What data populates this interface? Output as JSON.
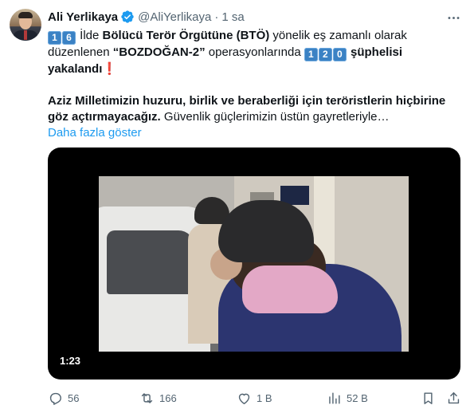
{
  "author": {
    "name": "Ali Yerlikaya",
    "handle": "@AliYerlikaya",
    "separator": "·",
    "time": "1 sa"
  },
  "tweet": {
    "line1": {
      "keys1": [
        "1",
        "6"
      ],
      "t1": " İlde ",
      "b1": "Bölücü Terör Örgütüne (BTÖ)",
      "t2": " yönelik eş zamanlı olarak"
    },
    "line2": {
      "t1": "düzenlenen ",
      "b1": "“BOZDOĞAN-2”",
      "t2": " operasyonlarında ",
      "keys2": [
        "1",
        "2",
        "0"
      ],
      "b2": " şüphelisi"
    },
    "line3": {
      "b1": "yakalandı",
      "mark": "❗"
    },
    "line4": {
      "b1": "Aziz Milletimizin huzuru, birlik ve beraberliği için teröristlerin hiçbirine"
    },
    "line5": {
      "b1": "göz açtırmayacağız.",
      "t1": " Güvenlik güçlerimizin üstün gayretleriyle…"
    },
    "show_more": "Daha fazla göster"
  },
  "media": {
    "duration": "1:23"
  },
  "actions": {
    "reply": {
      "icon": "reply-icon",
      "count": "56"
    },
    "repost": {
      "icon": "repost-icon",
      "count": "166"
    },
    "like": {
      "icon": "heart-icon",
      "count": "1 B"
    },
    "views": {
      "icon": "views-icon",
      "count": "52 B"
    },
    "bookmark": {
      "icon": "bookmark-icon"
    },
    "share": {
      "icon": "share-icon"
    }
  },
  "colors": {
    "accent": "#1d9bf0",
    "secondary_text": "#536471",
    "keycap": "#3b82c4",
    "exclamation": "#e0245e"
  }
}
